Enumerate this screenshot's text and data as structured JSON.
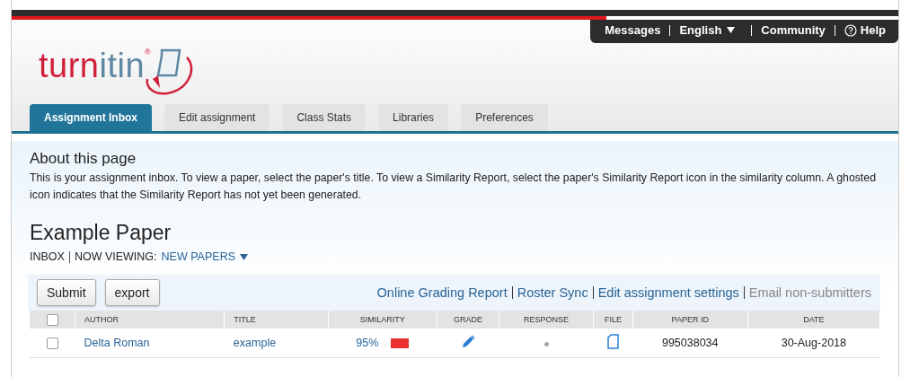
{
  "top_links": [
    {
      "label": "Messages",
      "kind": "link"
    },
    {
      "label": "English",
      "kind": "dropdown"
    },
    {
      "label": "Community",
      "kind": "link"
    },
    {
      "label": "Help",
      "kind": "help"
    }
  ],
  "logo": {
    "parts": [
      "turn",
      "itin"
    ],
    "mark": "®"
  },
  "tabs": [
    {
      "label": "Assignment Inbox",
      "selected": true
    },
    {
      "label": "Edit assignment",
      "selected": false
    },
    {
      "label": "Class Stats",
      "selected": false
    },
    {
      "label": "Libraries",
      "selected": false
    },
    {
      "label": "Preferences",
      "selected": false
    }
  ],
  "about": {
    "title": "About this page",
    "text": "This is your assignment inbox. To view a paper, select the paper's title. To view a Similarity Report, select the paper's Similarity Report icon in the similarity column. A ghosted icon indicates that the Similarity Report has not yet been generated."
  },
  "assignment": {
    "title": "Example Paper",
    "inbox": "INBOX",
    "viewing_label": "NOW VIEWING:",
    "viewing": "NEW PAPERS"
  },
  "buttons": [
    "Submit",
    "export"
  ],
  "actions": [
    {
      "label": "Online Grading Report",
      "disabled": false
    },
    {
      "label": "Roster Sync",
      "disabled": false
    },
    {
      "label": "Edit assignment settings",
      "disabled": false
    },
    {
      "label": "Email non-submitters",
      "disabled": true
    }
  ],
  "table": {
    "select_all_checked": false,
    "columns": [
      "AUTHOR",
      "TITLE",
      "SIMILARITY",
      "GRADE",
      "RESPONSE",
      "FILE",
      "PAPER ID",
      "DATE"
    ],
    "rows": [
      {
        "checked": false,
        "author": "Delta Roman",
        "title": "example",
        "similarity": "95%",
        "paper_id": "995038034",
        "date": "30-Aug-2018"
      }
    ]
  }
}
